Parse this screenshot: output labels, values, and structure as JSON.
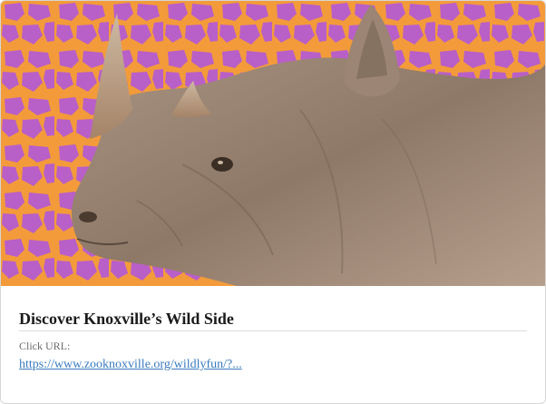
{
  "ad": {
    "image_subject": "rhino-photo",
    "title": "Discover Knoxville’s Wild Side",
    "click_label": "Click URL:",
    "click_url": "https://www.zooknoxville.org/wildlyfun/?..."
  },
  "colors": {
    "background_orange": "#f39b3a",
    "pattern_purple": "#b95fc8",
    "link_blue": "#3a7bbf",
    "title_text": "#1b1b1b"
  }
}
